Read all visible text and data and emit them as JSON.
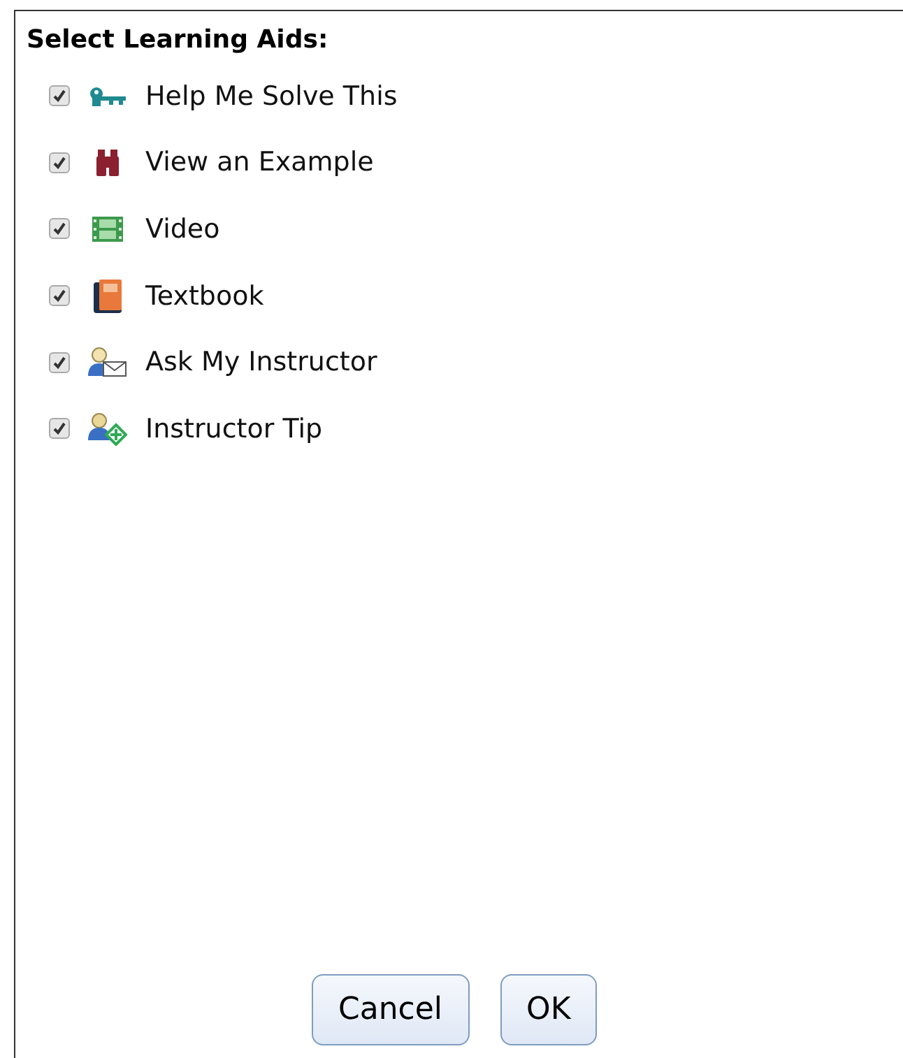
{
  "title": "Select Learning Aids:",
  "aids": [
    {
      "label": "Help Me Solve This",
      "checked": true
    },
    {
      "label": "View an Example",
      "checked": true
    },
    {
      "label": "Video",
      "checked": true
    },
    {
      "label": "Textbook",
      "checked": true
    },
    {
      "label": "Ask My Instructor",
      "checked": true
    },
    {
      "label": "Instructor Tip",
      "checked": true
    }
  ],
  "buttons": [
    {
      "label": "Cancel"
    },
    {
      "label": "OK"
    }
  ]
}
